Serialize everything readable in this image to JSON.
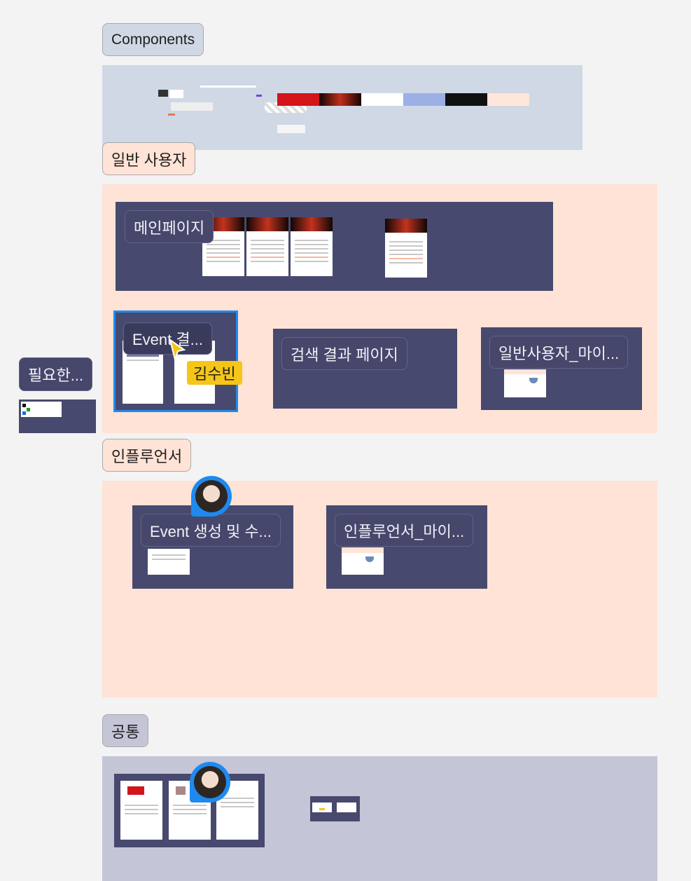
{
  "sections": {
    "components": "Components",
    "general_user": "일반 사용자",
    "influencer": "인플루언서",
    "common": "공통"
  },
  "frames": {
    "main_page": "메인페이지",
    "event_result": "Event 결...",
    "search_result": "검색 결과 페이지",
    "general_user_my": "일반사용자_마이...",
    "event_create": "Event 생성 및 수...",
    "influencer_my": "인플루언서_마이...",
    "required": "필요한..."
  },
  "collaborator": {
    "name": "김수빈",
    "cursor_color": "#f5c518"
  },
  "colors": {
    "canvas": "#f3f3f3",
    "components_bg": "#cfd8e4",
    "section_peach": "#ffe3d6",
    "common_bg": "#c4c5d7",
    "frame_dark": "#48496e",
    "selection": "#1e8af0"
  },
  "icons": [
    "cursor-arrow-icon",
    "collaborator-avatar-icon"
  ]
}
